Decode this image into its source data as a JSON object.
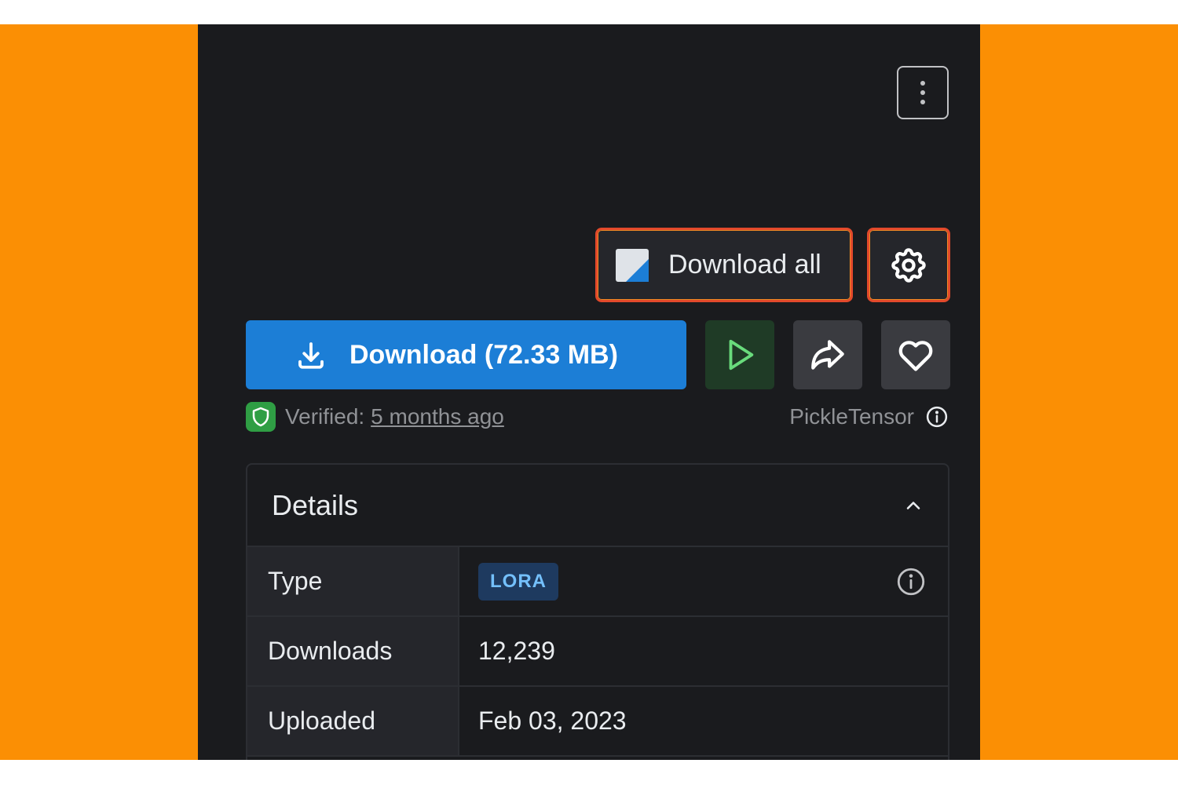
{
  "toolbar": {
    "download_all_label": "Download all",
    "download_label": "Download (72.33 MB)"
  },
  "verification": {
    "label": "Verified:",
    "time": "5 months ago",
    "author": "PickleTensor"
  },
  "details": {
    "title": "Details",
    "rows": [
      {
        "key": "Type",
        "value": "LORA"
      },
      {
        "key": "Downloads",
        "value": "12,239"
      },
      {
        "key": "Uploaded",
        "value": "Feb 03, 2023"
      }
    ]
  },
  "icons": {
    "kebab": "more-vertical-icon",
    "download_all": "download-all-icon",
    "settings": "gear-icon",
    "download": "download-icon",
    "play": "play-icon",
    "share": "share-icon",
    "favorite": "heart-icon",
    "verified": "shield-check-icon",
    "info": "info-icon",
    "collapse": "chevron-up-icon"
  },
  "colors": {
    "accent": "#1c7ed6",
    "highlight": "#e2492b",
    "verified": "#2f9e44",
    "background": "#1a1b1e",
    "frame": "#fb8f04"
  }
}
